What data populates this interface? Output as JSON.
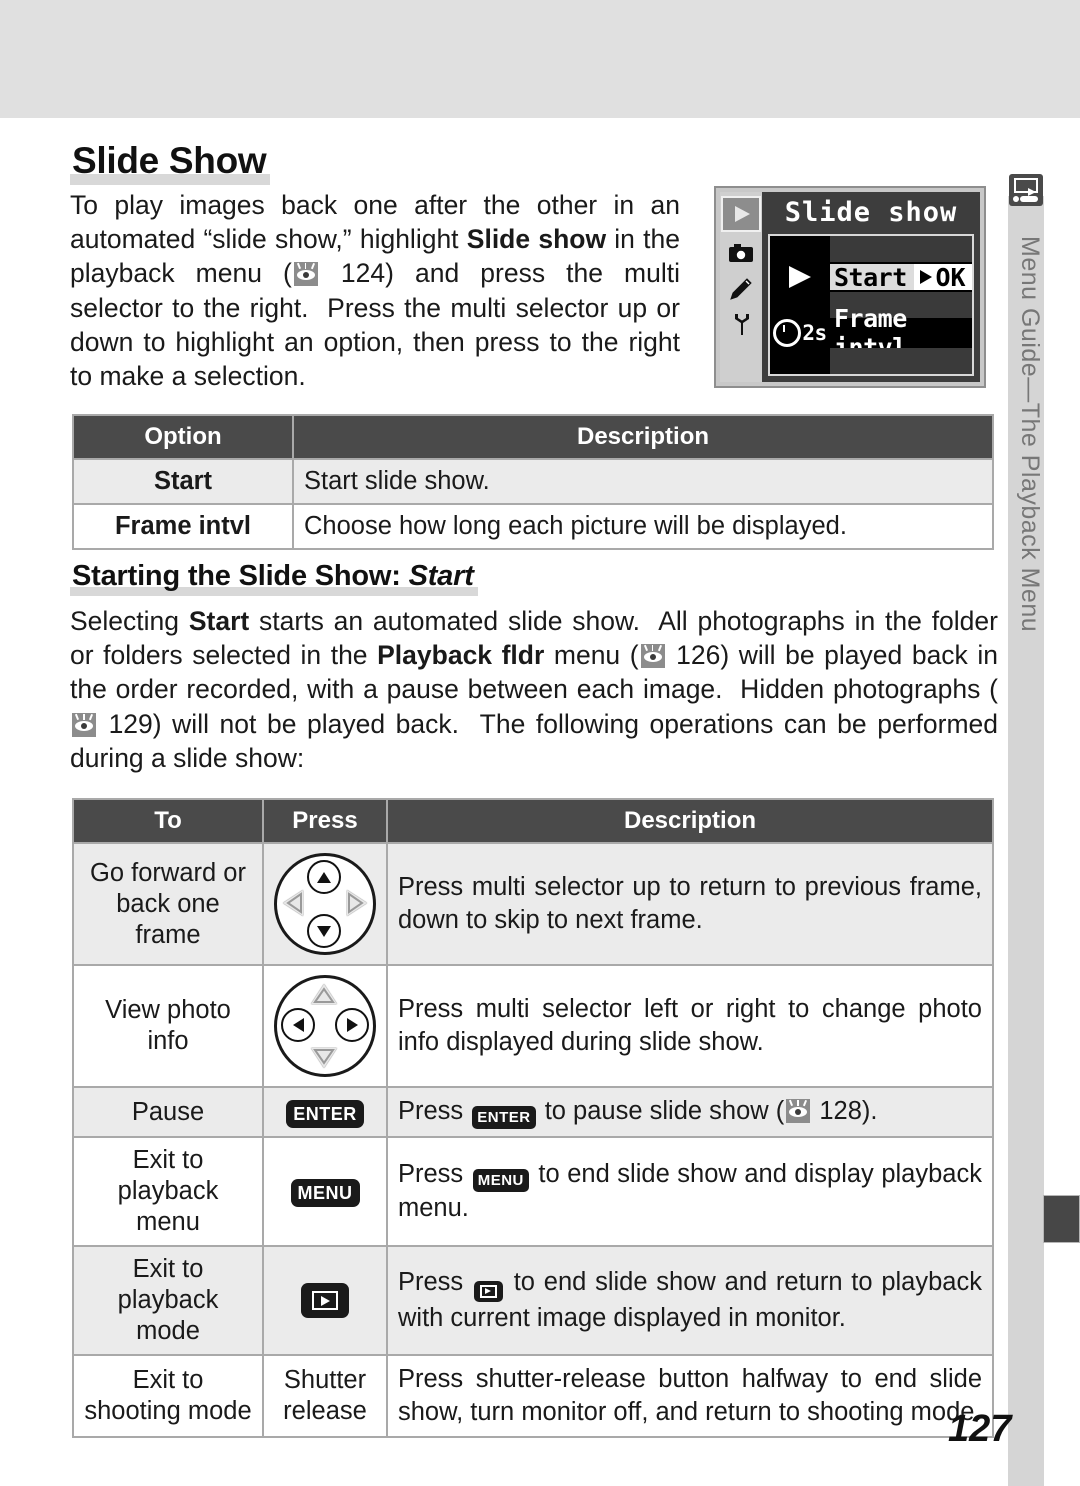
{
  "page": {
    "number": "127",
    "side_tab": "Menu Guide—The Playback Menu",
    "side_tab_icon": "playback-icon"
  },
  "section": {
    "heading": "Slide Show",
    "intro_html": "To play images back one after the other in an automated “slide show,” highlight <b>Slide show</b> in the playback menu (<span class=\"eye\" data-name=\"page-ref-eye-icon\" data-interactable=\"false\"><u></u><u class=\"b\"></u><u class=\"c\"></u><i></i></span> 124) and press the multi selector to the right.&nbsp; Press the multi selector up or down to highlight an option, then press to the right to make a selection."
  },
  "lcd": {
    "title": "Slide show",
    "sidebar_icons": [
      "playback-icon",
      "camera-icon",
      "pencil-icon",
      "wrench-icon"
    ],
    "rows": [
      {
        "label": "Start",
        "icon": "play-triangle-icon",
        "badge": "OK",
        "highlighted": true
      },
      {
        "label": "Frame intvl",
        "icon": "clock-icon",
        "value": "2s",
        "highlighted": false
      }
    ]
  },
  "options_table": {
    "headers": [
      "Option",
      "Description"
    ],
    "rows": [
      {
        "option": "Start",
        "description": "Start slide show."
      },
      {
        "option": "Frame intvl",
        "description": "Choose how long each picture will be displayed."
      }
    ]
  },
  "subsection": {
    "heading_plain": "Starting the Slide Show: ",
    "heading_italic": "Start",
    "body_html": "Selecting <b>Start</b> starts an automated slide show.&nbsp; All photographs in the folder or folders selected in the <b>Playback fldr</b> menu (<span class=\"eye\" data-name=\"page-ref-eye-icon\" data-interactable=\"false\"><u></u><u class=\"b\"></u><u class=\"c\"></u><i></i></span> 126) will be played back in the order recorded, with a pause between each image.&nbsp; Hidden photographs (<span class=\"eye\" data-name=\"page-ref-eye-icon\" data-interactable=\"false\"><u></u><u class=\"b\"></u><u class=\"c\"></u><i></i></span> 129) will not be played back.&nbsp; The following operations can be performed during a slide show:"
  },
  "operations_table": {
    "headers": [
      "To",
      "Press",
      "Description"
    ],
    "rows": [
      {
        "to": "Go forward or back one frame",
        "press_icon": "multi-selector-up-down-icon",
        "press_label": "",
        "description_html": "Press multi selector up to return to previous frame, down to skip to next frame."
      },
      {
        "to": "View photo info",
        "press_icon": "multi-selector-left-right-icon",
        "press_label": "",
        "description_html": "Press multi selector left or right to change photo info displayed during slide show."
      },
      {
        "to": "Pause",
        "press_icon": "enter-button-icon",
        "press_label": "ENTER",
        "description_html": "Press <span class=\"btn btn-inline\" data-name=\"enter-button-icon\" data-interactable=\"false\">ENTER</span> to pause slide show (<span class=\"eye\" data-name=\"page-ref-eye-icon\" data-interactable=\"false\"><u></u><u class=\"b\"></u><u class=\"c\"></u><i></i></span> 128)."
      },
      {
        "to": "Exit to playback menu",
        "press_icon": "menu-button-icon",
        "press_label": "MENU",
        "description_html": "Press <span class=\"btn btn-inline\" data-name=\"menu-button-icon\" data-interactable=\"false\">MENU</span> to end slide show and display playback menu."
      },
      {
        "to": "Exit to playback mode",
        "press_icon": "playback-button-icon",
        "press_label": "",
        "description_html": "Press <span class=\"pbtn pbtn-inline\" data-name=\"playback-button-icon\" data-interactable=\"false\"><span class=\"in\"><span class=\"tt\"></span></span></span> to end slide show and return to playback with current image displayed in monitor."
      },
      {
        "to": "Exit to shooting mode",
        "press_icon": "",
        "press_label": "Shutter release",
        "description_html": "Press shutter-release button halfway to end slide show, turn monitor off, and return to shooting mode."
      }
    ]
  }
}
